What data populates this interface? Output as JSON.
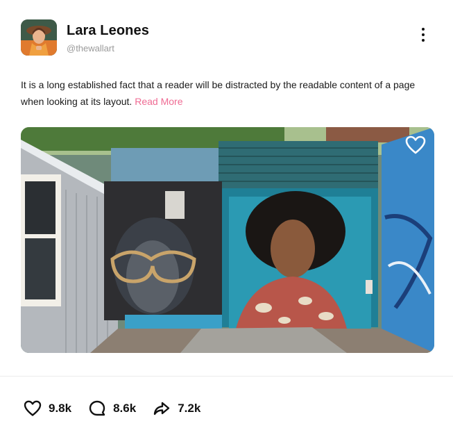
{
  "post": {
    "author": {
      "name": "Lara Leones",
      "handle": "@thewallart",
      "avatar_icon": "woman-portrait-avatar"
    },
    "text": "It is a long established fact that a reader will be distracted by the readable content of a page when looking at its layout.",
    "read_more_label": "Read More",
    "image_icon": "street-art-mural-photo",
    "stats": {
      "likes": "9.8k",
      "comments": "8.6k",
      "shares": "7.2k"
    }
  },
  "icons": {
    "more": "more-vertical-icon",
    "favorite": "heart-outline-icon",
    "like": "heart-icon",
    "comment": "comment-bubble-icon",
    "share": "share-arrow-icon"
  },
  "colors": {
    "accent": "#ef6b93",
    "text": "#1a1a1a",
    "muted": "#9a9a9a"
  }
}
